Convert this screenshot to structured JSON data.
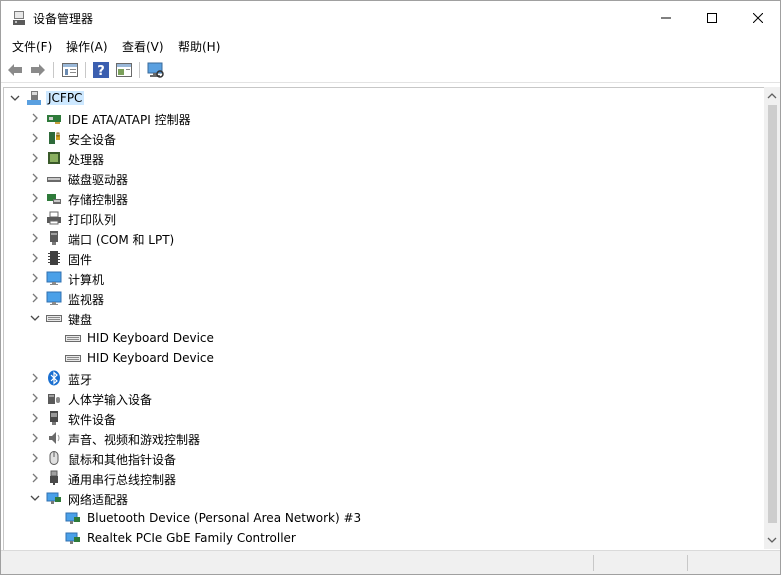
{
  "window": {
    "title": "设备管理器",
    "controls": {
      "minimize": "minimize",
      "maximize": "maximize",
      "close": "close"
    }
  },
  "menubar": {
    "items": [
      "文件(F)",
      "操作(A)",
      "查看(V)",
      "帮助(H)"
    ]
  },
  "toolbar": {
    "buttons": [
      "back-arrow",
      "forward-arrow",
      "properties-pane",
      "help",
      "scan-view",
      "monitor-scan"
    ]
  },
  "tree": {
    "root": "JCFPC",
    "categories": [
      {
        "label": "IDE ATA/ATAPI 控制器",
        "icon": "ide-controller-icon",
        "expanded": false
      },
      {
        "label": "安全设备",
        "icon": "security-device-icon",
        "expanded": false
      },
      {
        "label": "处理器",
        "icon": "processor-icon",
        "expanded": false
      },
      {
        "label": "磁盘驱动器",
        "icon": "disk-drive-icon",
        "expanded": false
      },
      {
        "label": "存储控制器",
        "icon": "storage-controller-icon",
        "expanded": false
      },
      {
        "label": "打印队列",
        "icon": "printer-icon",
        "expanded": false
      },
      {
        "label": "端口 (COM 和 LPT)",
        "icon": "port-icon",
        "expanded": false
      },
      {
        "label": "固件",
        "icon": "firmware-icon",
        "expanded": false
      },
      {
        "label": "计算机",
        "icon": "computer-icon",
        "expanded": false
      },
      {
        "label": "监视器",
        "icon": "monitor-icon",
        "expanded": false
      },
      {
        "label": "键盘",
        "icon": "keyboard-icon",
        "expanded": true,
        "children": [
          "HID Keyboard Device",
          "HID Keyboard Device"
        ]
      },
      {
        "label": "蓝牙",
        "icon": "bluetooth-icon",
        "expanded": false
      },
      {
        "label": "人体学输入设备",
        "icon": "hid-icon",
        "expanded": false
      },
      {
        "label": "软件设备",
        "icon": "software-device-icon",
        "expanded": false
      },
      {
        "label": "声音、视频和游戏控制器",
        "icon": "speaker-icon",
        "expanded": false
      },
      {
        "label": "鼠标和其他指针设备",
        "icon": "mouse-icon",
        "expanded": false
      },
      {
        "label": "通用串行总线控制器",
        "icon": "usb-icon",
        "expanded": false
      },
      {
        "label": "网络适配器",
        "icon": "network-adapter-icon",
        "expanded": true,
        "children": [
          "Bluetooth Device (Personal Area Network) #3",
          "Realtek PCIe GbE Family Controller"
        ]
      }
    ]
  },
  "colors": {
    "selection": "#cde8ff",
    "chevron": "#7a7a7a",
    "scroll_track": "#f0f0f0",
    "scroll_thumb": "#cdcdcd"
  }
}
